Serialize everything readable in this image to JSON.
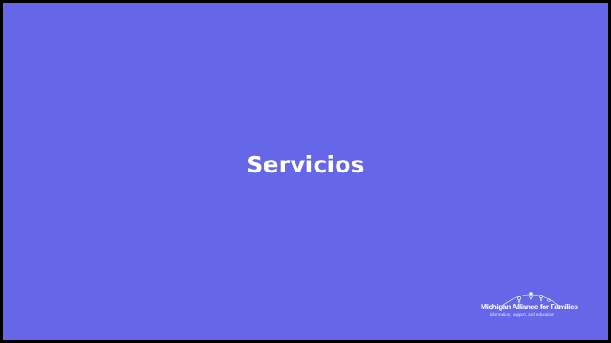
{
  "slide": {
    "title": "Servicios",
    "background_color": "#6666e8",
    "text_color": "#ffffff"
  },
  "logo": {
    "name": "Michigan Alliance for Families",
    "tagline": "information, support, and education",
    "icon": "families-arc-logo"
  }
}
